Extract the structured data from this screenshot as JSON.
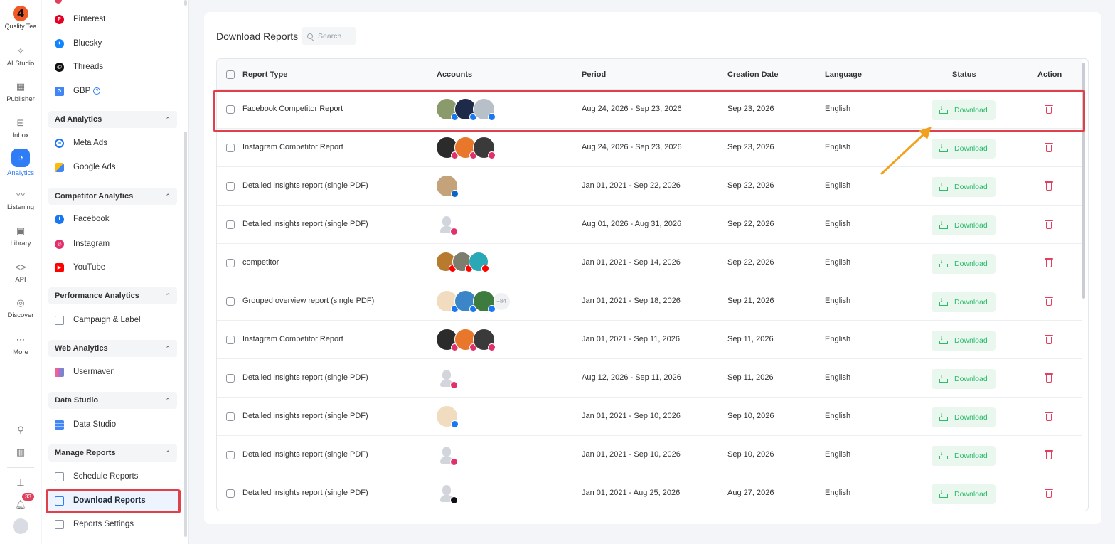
{
  "rail": {
    "logo_text": "Quality Tea",
    "items": [
      {
        "label": "AI Studio",
        "icon": "sparkle-icon"
      },
      {
        "label": "Publisher",
        "icon": "calendar-icon"
      },
      {
        "label": "Inbox",
        "icon": "inbox-icon"
      },
      {
        "label": "Analytics",
        "icon": "pie-chart-icon"
      },
      {
        "label": "Listening",
        "icon": "rss-icon"
      },
      {
        "label": "Library",
        "icon": "image-library-icon"
      },
      {
        "label": "API",
        "icon": "code-icon"
      },
      {
        "label": "Discover",
        "icon": "compass-icon"
      },
      {
        "label": "More",
        "icon": "ellipsis-icon"
      }
    ],
    "notification_count": "33"
  },
  "sidebar": {
    "top_items": [
      "Pinterest",
      "Bluesky",
      "Threads",
      "GBP"
    ],
    "sections": [
      {
        "title": "Ad Analytics",
        "items": [
          "Meta Ads",
          "Google Ads"
        ]
      },
      {
        "title": "Competitor Analytics",
        "items": [
          "Facebook",
          "Instagram",
          "YouTube"
        ]
      },
      {
        "title": "Performance Analytics",
        "items": [
          "Campaign & Label"
        ]
      },
      {
        "title": "Web Analytics",
        "items": [
          "Usermaven"
        ]
      },
      {
        "title": "Data Studio",
        "items": [
          "Data Studio"
        ]
      },
      {
        "title": "Manage Reports",
        "items": [
          "Schedule Reports",
          "Download Reports",
          "Reports Settings"
        ]
      }
    ],
    "active_item": "Download Reports"
  },
  "main": {
    "title": "Download Reports",
    "search_placeholder": "Search",
    "columns": [
      "Report Type",
      "Accounts",
      "Period",
      "Creation Date",
      "Language",
      "Status",
      "Action"
    ],
    "download_label": "Download",
    "more_accounts": "+84",
    "rows": [
      {
        "type": "Facebook Competitor Report",
        "period": "Aug 24, 2026 - Sep 23, 2026",
        "created": "Sep 23, 2026",
        "language": "English"
      },
      {
        "type": "Instagram Competitor Report",
        "period": "Aug 24, 2026 - Sep 23, 2026",
        "created": "Sep 23, 2026",
        "language": "English"
      },
      {
        "type": "Detailed insights report (single PDF)",
        "period": "Jan 01, 2021 - Sep 22, 2026",
        "created": "Sep 22, 2026",
        "language": "English"
      },
      {
        "type": "Detailed insights report (single PDF)",
        "period": "Aug 01, 2026 - Aug 31, 2026",
        "created": "Sep 22, 2026",
        "language": "English"
      },
      {
        "type": "competitor",
        "period": "Jan 01, 2021 - Sep 14, 2026",
        "created": "Sep 22, 2026",
        "language": "English"
      },
      {
        "type": "Grouped overview report (single PDF)",
        "period": "Jan 01, 2021 - Sep 18, 2026",
        "created": "Sep 21, 2026",
        "language": "English"
      },
      {
        "type": "Instagram Competitor Report",
        "period": "Jan 01, 2021 - Sep 11, 2026",
        "created": "Sep 11, 2026",
        "language": "English"
      },
      {
        "type": "Detailed insights report (single PDF)",
        "period": "Aug 12, 2026 - Sep 11, 2026",
        "created": "Sep 11, 2026",
        "language": "English"
      },
      {
        "type": "Detailed insights report (single PDF)",
        "period": "Jan 01, 2021 - Sep 10, 2026",
        "created": "Sep 10, 2026",
        "language": "English"
      },
      {
        "type": "Detailed insights report (single PDF)",
        "period": "Jan 01, 2021 - Sep 10, 2026",
        "created": "Sep 10, 2026",
        "language": "English"
      },
      {
        "type": "Detailed insights report (single PDF)",
        "period": "Jan 01, 2021 - Aug 25, 2026",
        "created": "Aug 27, 2026",
        "language": "English"
      }
    ]
  },
  "colors": {
    "accent": "#2f7df6",
    "download_text": "#2dba6a",
    "download_bg": "#e9f7ef",
    "delete": "#e0405b",
    "highlight": "#e0404a",
    "arrow": "#f2a11f"
  }
}
